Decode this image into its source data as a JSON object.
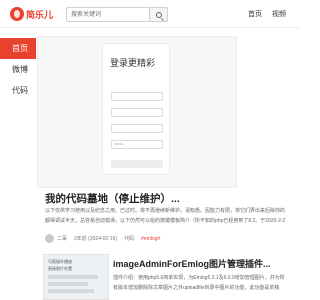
{
  "header": {
    "logo_text": "简乐儿",
    "search_placeholder": "搜索关键词",
    "nav": [
      "首页",
      "视频"
    ]
  },
  "sidebar": {
    "items": [
      {
        "label": "首页",
        "active": true
      },
      {
        "label": "微博",
        "active": false
      },
      {
        "label": "代码",
        "active": false
      }
    ]
  },
  "posts": [
    {
      "image": {
        "login_title": "登录更精彩",
        "fields": [
          "",
          "",
          "",
          "4f6d6a"
        ]
      },
      "title": "我的代码墓地（停止维护）...",
      "excerpt_lines": [
        "以下仅供学习使用以及纪念之用。已过时。将不再继续新维护。请知悉。因能力有限，将它们弄出来后除你的",
        "都得调试半天，总容易自动错误，以下仍然可以给的按键模板简介（所不知的php已经用到了8.2。于2025-2-2"
      ],
      "meta": {
        "author": "二呆",
        "date": "2年前 (2024-02-16)",
        "category": "代码",
        "tag": "#emlog#"
      }
    },
    {
      "thumb": {
        "title": "可直接外播放",
        "subtitle": "直接图片外置"
      },
      "title": "imageAdminForEmlog图片管理插件...",
      "excerpt_lines": [
        "插件介绍：使用php5.6简单实现，为Emlog5.3.1及6.0.0增加管理图片，并为所",
        "有版本增加删除除文章图片之外uploadfile目录中图片的功能，此功能是单独"
      ]
    }
  ]
}
